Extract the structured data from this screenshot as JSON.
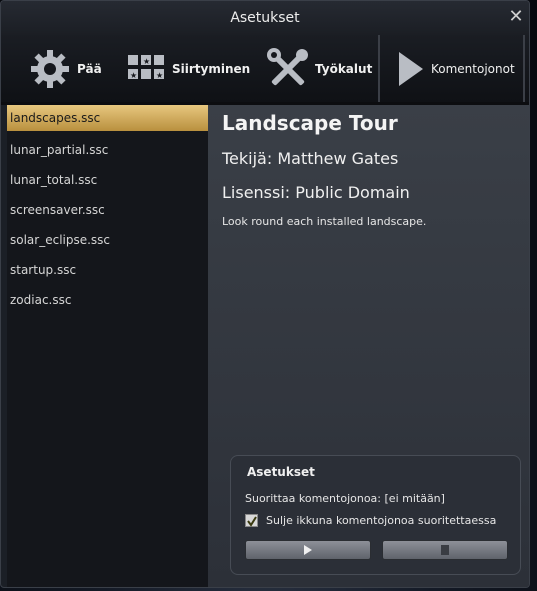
{
  "window": {
    "title": "Asetukset"
  },
  "toolbar": {
    "items": [
      {
        "label": "Pää",
        "icon": "gear-icon"
      },
      {
        "label": "Siirtyminen",
        "icon": "navigation-grid-icon"
      },
      {
        "label": "Työkalut",
        "icon": "tools-icon"
      },
      {
        "label": "Komentojonot",
        "icon": "play-icon"
      }
    ]
  },
  "scripts": {
    "items": [
      {
        "label": "landscapes.ssc"
      },
      {
        "label": "lunar_partial.ssc"
      },
      {
        "label": "lunar_total.ssc"
      },
      {
        "label": "screensaver.ssc"
      },
      {
        "label": "solar_eclipse.ssc"
      },
      {
        "label": "startup.ssc"
      },
      {
        "label": "zodiac.ssc"
      }
    ],
    "selected_index": 0
  },
  "details": {
    "title": "Landscape Tour",
    "author": "Tekijä: Matthew Gates",
    "license": "Lisenssi: Public Domain",
    "description": "Look round each installed landscape."
  },
  "options": {
    "title": "Asetukset",
    "running": "Suorittaa komentojonoa: [ei mitään]",
    "close_label": "Sulje ikkuna komentojonoa suoritettaessa",
    "close_checked": true
  },
  "colors": {
    "selected": "#d9b464",
    "accent": "#e8e8e8"
  }
}
